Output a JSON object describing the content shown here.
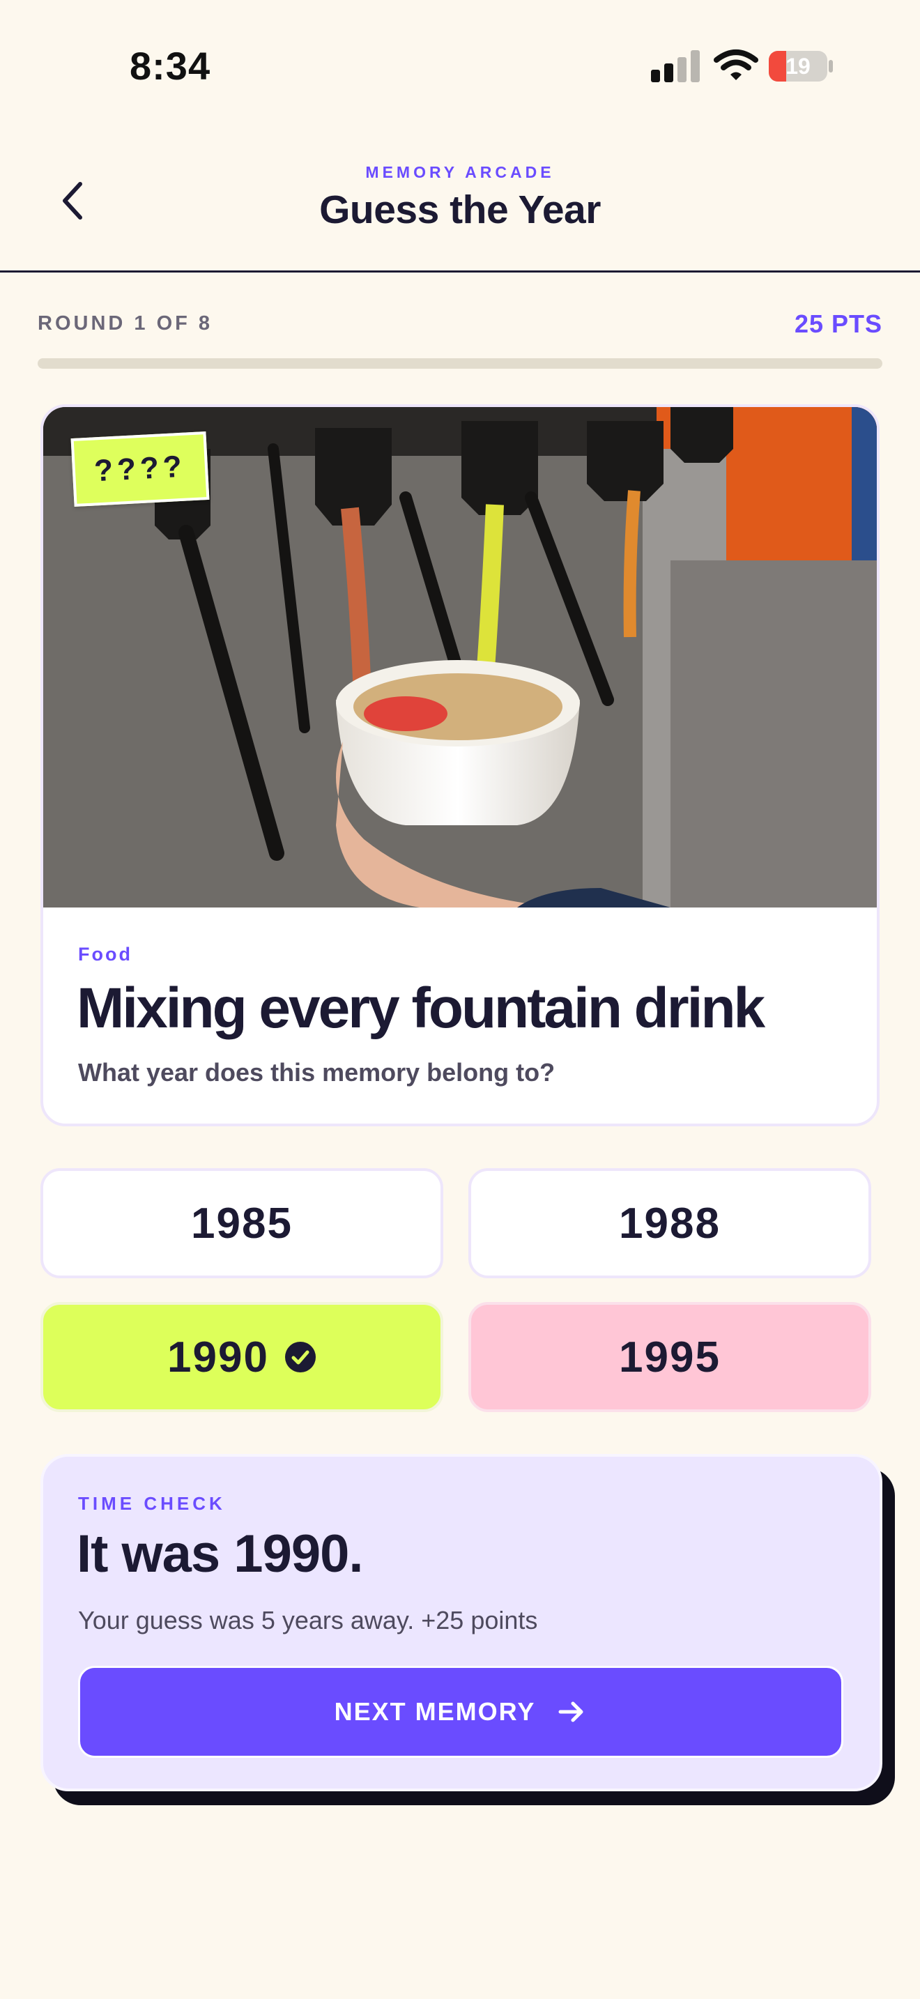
{
  "status_bar": {
    "time": "8:34",
    "battery": "19"
  },
  "header": {
    "eyebrow": "MEMORY ARCADE",
    "title": "Guess the Year",
    "back_icon": "chevron-left-icon"
  },
  "round": {
    "label": "ROUND 1 OF 8",
    "points": "25 PTS",
    "progress": 0
  },
  "memory": {
    "sticker": "????",
    "category": "Food",
    "title": "Mixing every fountain drink",
    "question": "What year does this memory belong to?"
  },
  "options": [
    {
      "year": "1985",
      "state": "default"
    },
    {
      "year": "1988",
      "state": "default"
    },
    {
      "year": "1990",
      "state": "correct",
      "icon": "check-circle-icon"
    },
    {
      "year": "1995",
      "state": "selected-wrong"
    }
  ],
  "result": {
    "eyebrow": "TIME CHECK",
    "title": "It was 1990.",
    "detail": "Your guess was 5 years away.  +25 points",
    "next_label": "NEXT MEMORY",
    "next_icon": "arrow-right-icon"
  },
  "colors": {
    "background": "#FDF8EE",
    "accent": "#6A4CFF",
    "correct": "#DDFF5A",
    "wrong": "#FFC6D6",
    "result_card": "#ECE6FF"
  }
}
